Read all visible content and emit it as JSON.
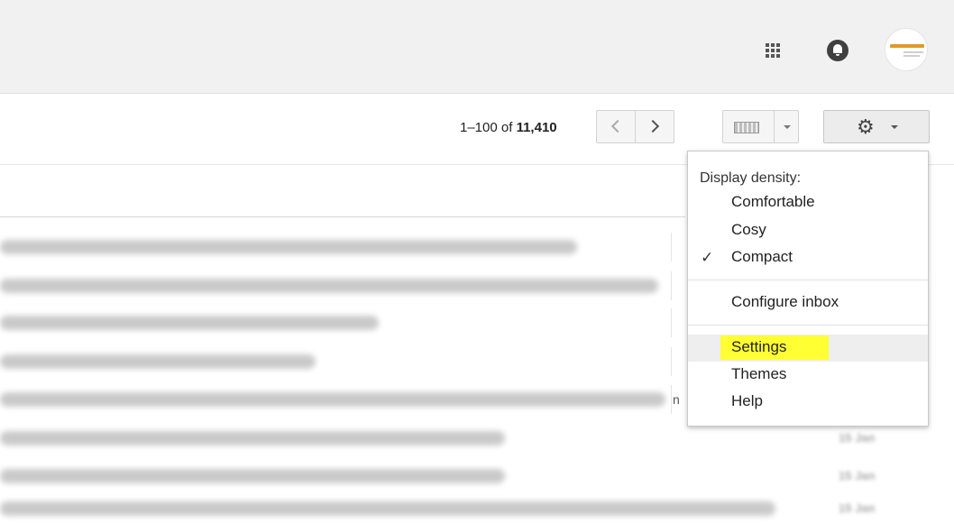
{
  "toolbar": {
    "page_range": "1–100",
    "page_of": " of ",
    "page_total": "11,410"
  },
  "icons": {
    "apps": "apps-grid-icon",
    "notifications": "bell-icon",
    "settings": "gear-icon",
    "keyboard": "keyboard-icon"
  },
  "colors": {
    "topbar": "#f1f1f1",
    "highlight": "#ffff33"
  },
  "settings_menu": {
    "density_heading": "Display density:",
    "density_options": [
      "Comfortable",
      "Cosy",
      "Compact"
    ],
    "selected_density": "Compact",
    "check_mark": "✓",
    "configure_inbox": "Configure inbox",
    "settings": "Settings",
    "themes": "Themes",
    "help": "Help"
  },
  "email_list": {
    "rows": [
      {
        "partial": "",
        "date": ""
      },
      {
        "partial": "",
        "date": ""
      },
      {
        "partial": "",
        "date": ""
      },
      {
        "partial": "",
        "date": ""
      },
      {
        "partial": "n",
        "date": ""
      },
      {
        "partial": "",
        "date": "15 Jan"
      },
      {
        "partial": "",
        "date": "15 Jan"
      },
      {
        "partial": "",
        "date": "15 Jan"
      }
    ]
  }
}
